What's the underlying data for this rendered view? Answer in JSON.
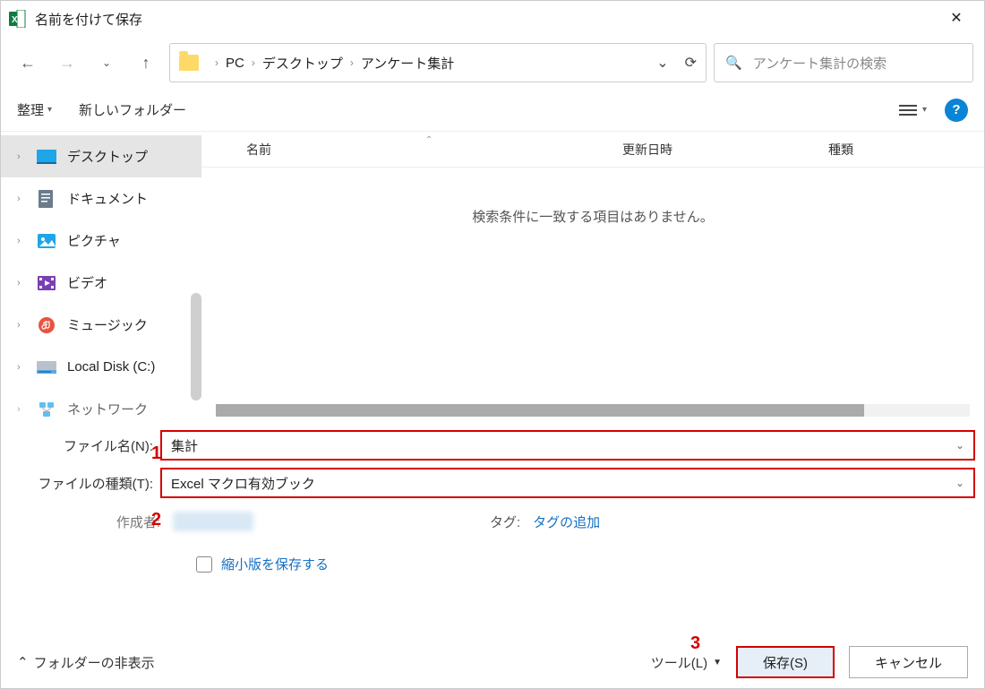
{
  "window": {
    "title": "名前を付けて保存"
  },
  "breadcrumbs": {
    "a": "PC",
    "b": "デスクトップ",
    "c": "アンケート集計"
  },
  "search": {
    "placeholder": "アンケート集計の検索"
  },
  "toolbar": {
    "organize": "整理",
    "newfolder": "新しいフォルダー"
  },
  "columns": {
    "name": "名前",
    "date": "更新日時",
    "type": "種類"
  },
  "empty_msg": "検索条件に一致する項目はありません。",
  "sidebar": {
    "desktop": "デスクトップ",
    "documents": "ドキュメント",
    "pictures": "ピクチャ",
    "videos": "ビデオ",
    "music": "ミュージック",
    "localdisk": "Local Disk (C:)",
    "network": "ネットワーク"
  },
  "form": {
    "filename_label": "ファイル名(N):",
    "filename_value": "集計",
    "filetype_label": "ファイルの種類(T):",
    "filetype_value": "Excel マクロ有効ブック",
    "author_label": "作成者:",
    "tag_label": "タグ:",
    "tag_link": "タグの追加",
    "thumbnail": "縮小版を保存する"
  },
  "bottom": {
    "hide_folders": "フォルダーの非表示",
    "tools": "ツール(L)",
    "save": "保存(S)",
    "cancel": "キャンセル"
  },
  "annot": {
    "n1": "1",
    "n2": "2",
    "n3": "3"
  }
}
